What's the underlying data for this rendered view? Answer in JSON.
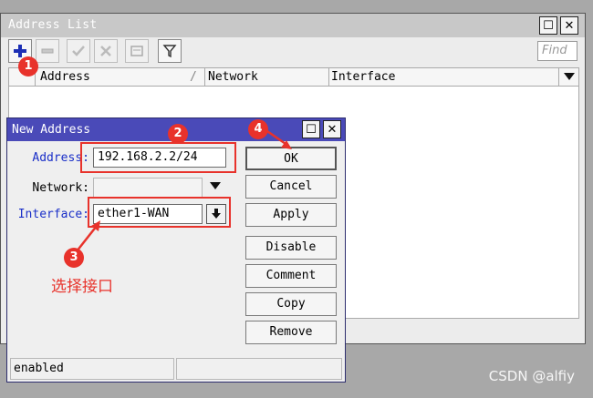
{
  "address_list": {
    "title": "Address List",
    "find_placeholder": "Find",
    "columns": [
      "Address",
      "/",
      "Network",
      "Interface"
    ]
  },
  "new_address": {
    "title": "New Address",
    "address_label": "Address:",
    "address_value": "192.168.2.2/24",
    "network_label": "Network:",
    "network_value": "",
    "interface_label": "Interface:",
    "interface_value": "ether1-WAN",
    "buttons": [
      "OK",
      "Cancel",
      "Apply",
      "Disable",
      "Comment",
      "Copy",
      "Remove"
    ],
    "status": "enabled"
  },
  "annotations": {
    "badges": [
      "1",
      "2",
      "3",
      "4"
    ],
    "note": "选择接口"
  },
  "watermark": "CSDN @alfiy",
  "colors": {
    "annotation_red": "#e8322b",
    "dialog_title": "#4a4ab8",
    "label_blue": "#1a2fc8"
  }
}
